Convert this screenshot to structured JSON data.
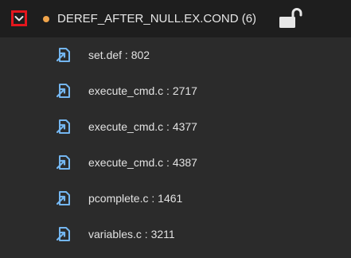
{
  "group": {
    "title": "DEREF_AFTER_NULL.EX.COND (6)",
    "status_color": "#f0a44b",
    "expanded": true,
    "toggle_icon": "chevron-down-icon",
    "lock_icon": "unlock-icon"
  },
  "items": [
    {
      "label": "set.def : 802",
      "icon": "file-link-icon"
    },
    {
      "label": "execute_cmd.c : 2717",
      "icon": "file-link-icon"
    },
    {
      "label": "execute_cmd.c : 4377",
      "icon": "file-link-icon"
    },
    {
      "label": "execute_cmd.c : 4387",
      "icon": "file-link-icon"
    },
    {
      "label": "pcomplete.c : 1461",
      "icon": "file-link-icon"
    },
    {
      "label": "variables.c : 3211",
      "icon": "file-link-icon"
    }
  ],
  "colors": {
    "header_bg": "#1e1e1e",
    "list_bg": "#2b2b2b",
    "highlight_border": "#e5161d",
    "icon_blue": "#74b6f0"
  }
}
